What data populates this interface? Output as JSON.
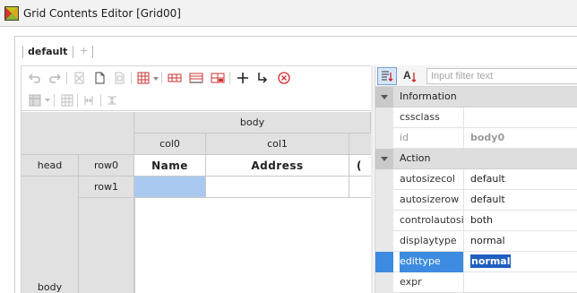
{
  "window": {
    "title": "Grid Contents Editor [Grid00]"
  },
  "tabs": {
    "active": "default",
    "add": "+"
  },
  "grid": {
    "band_body": "body",
    "col0": "col0",
    "col1": "col1",
    "head": "head",
    "row0": "row0",
    "row1": "row1",
    "body_label": "body",
    "cell_name": "Name",
    "cell_address": "Address"
  },
  "properties": {
    "filter_placeholder": "Input filter text",
    "sections": [
      {
        "label": "Information",
        "rows": [
          {
            "name": "cssclass",
            "value": ""
          },
          {
            "name": "id",
            "value": "body0"
          }
        ]
      },
      {
        "label": "Action",
        "rows": [
          {
            "name": "autosizecol",
            "value": "default"
          },
          {
            "name": "autosizerow",
            "value": "default"
          },
          {
            "name": "controlautosizingtype",
            "value": "both"
          },
          {
            "name": "displaytype",
            "value": "normal"
          },
          {
            "name": "edittype",
            "value": "normal"
          },
          {
            "name": "expr",
            "value": ""
          }
        ]
      }
    ]
  },
  "colors": {
    "accent": "#3c8be0",
    "selected_cell": "#a9c8f0",
    "header_gray": "#e1e1e1"
  }
}
